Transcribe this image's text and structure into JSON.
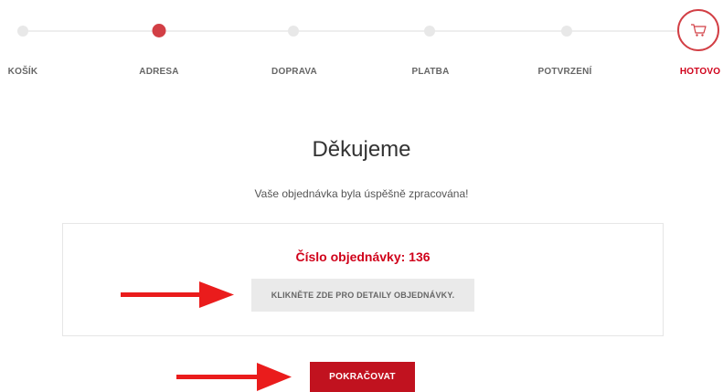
{
  "checkout": {
    "steps": [
      {
        "label": "KOŠÍK"
      },
      {
        "label": "ADRESA"
      },
      {
        "label": "DOPRAVA"
      },
      {
        "label": "PLATBA"
      },
      {
        "label": "POTVRZENÍ"
      },
      {
        "label": "HOTOVO"
      }
    ],
    "current_step": "HOTOVO",
    "final_icon": "cart-icon"
  },
  "confirmation": {
    "title": "Děkujeme",
    "subtitle": "Vaše objednávka byla úspěšně zpracována!",
    "order_number": "Číslo objednávky: 136",
    "details_label": "KLIKNĚTE ZDE PRO DETAILY OBJEDNÁVKY.",
    "continue_label": "POKRAČOVAT"
  },
  "colors": {
    "accent": "#d23f45",
    "button": "#c1121f",
    "annotation_arrow": "#ea1c1c"
  }
}
